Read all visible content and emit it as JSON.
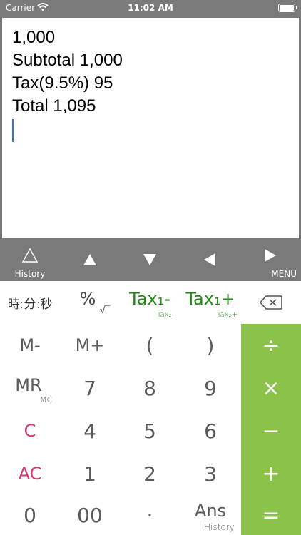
{
  "status_bar": {
    "carrier": "Carrier",
    "time": "11:02 AM",
    "icons": [
      "wifi-icon",
      "battery-icon"
    ]
  },
  "display": {
    "lines": [
      "1,000",
      "Subtotal 1,000",
      "Tax(9.5%) 95",
      "Total 1,095"
    ]
  },
  "navbar": {
    "history_label": "History",
    "menu_label": "MENU",
    "icons": [
      "history-triangle-icon",
      "arrow-up-icon",
      "arrow-down-icon",
      "arrow-left-icon",
      "arrow-right-icon"
    ]
  },
  "keys": {
    "time": "時:分:秒",
    "percent": "%",
    "sqrt": "√‾",
    "tax_minus": {
      "main": "Tax₁-",
      "sub": "Tax₂-"
    },
    "tax_plus": {
      "main": "Tax₁+",
      "sub": "Tax₂+"
    },
    "backspace_icon": "backspace-icon",
    "m_minus": "M-",
    "m_plus": "M+",
    "paren_open": "(",
    "paren_close": ")",
    "mr": {
      "main": "MR",
      "sub": "MC"
    },
    "seven": "7",
    "eight": "8",
    "nine": "9",
    "clear": "C",
    "four": "4",
    "five": "5",
    "six": "6",
    "all_clear": "AC",
    "one": "1",
    "two": "2",
    "three": "3",
    "zero": "0",
    "double_zero": "00",
    "decimal": "·",
    "ans": {
      "main": "Ans",
      "sub": "History"
    },
    "divide": "÷",
    "multiply": "×",
    "minus": "−",
    "plus": "+",
    "equals": "="
  },
  "colors": {
    "toolbar_gray": "#7a7a7a",
    "operator_green": "#8bc34a",
    "tax_green": "#1e8a12",
    "clear_pink": "#d83a6c",
    "caret_blue": "#3b6fd8"
  }
}
